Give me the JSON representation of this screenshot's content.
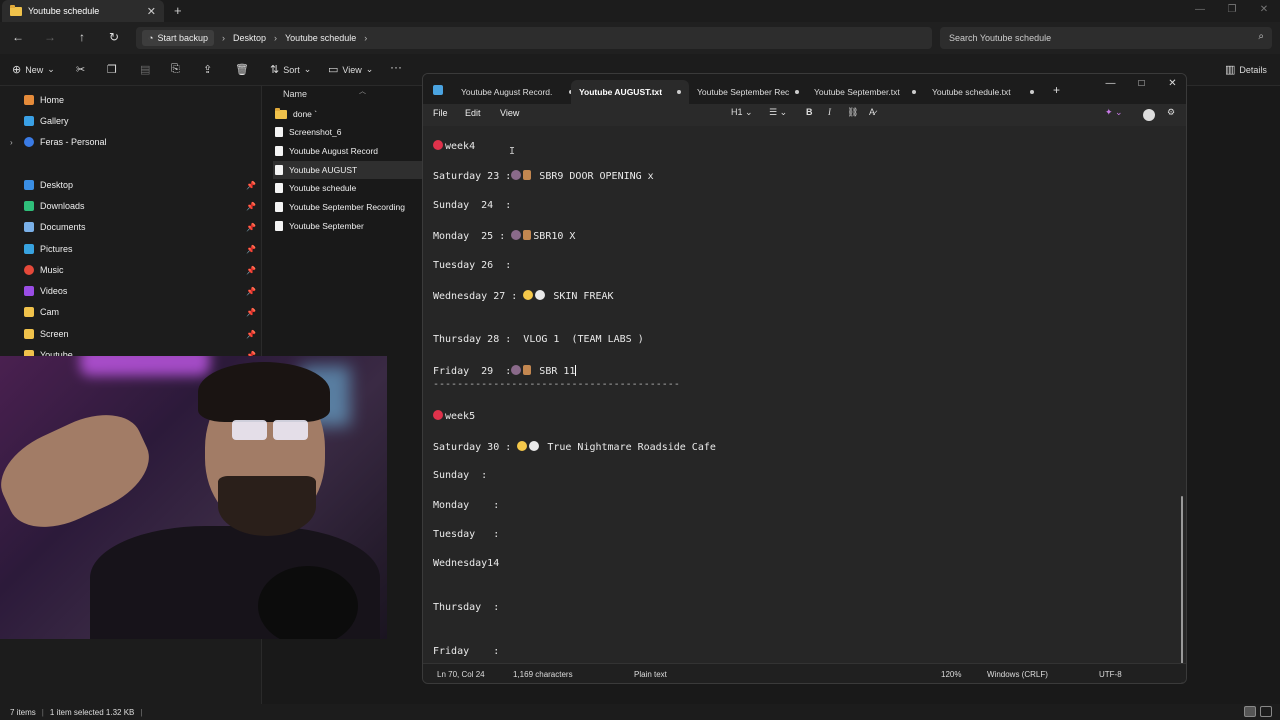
{
  "explorer": {
    "tab_title": "Youtube schedule",
    "new_tab": "+",
    "window_controls": [
      "—",
      "❐",
      "✕"
    ],
    "address": {
      "start_backup": "Start backup",
      "crumbs": [
        "Desktop",
        "Youtube schedule"
      ],
      "separator": "›"
    },
    "search_placeholder": "Search Youtube schedule",
    "commands": {
      "new": "New",
      "sort": "Sort",
      "view": "View",
      "more": "···",
      "details": "Details"
    },
    "sidebar": [
      {
        "label": "Home",
        "color": "#e58b3a"
      },
      {
        "label": "Gallery",
        "color": "#3aa0e5"
      },
      {
        "label": "Feras - Personal",
        "color": "#3a7be5"
      },
      {
        "label": "Desktop",
        "color": "#3a8fe5",
        "pinned": true
      },
      {
        "label": "Downloads",
        "color": "#2fbf7a",
        "pinned": true
      },
      {
        "label": "Documents",
        "color": "#7ab0e8",
        "pinned": true
      },
      {
        "label": "Pictures",
        "color": "#38a3e0",
        "pinned": true
      },
      {
        "label": "Music",
        "color": "#e5493a",
        "pinned": true
      },
      {
        "label": "Videos",
        "color": "#9a4de5",
        "pinned": true
      },
      {
        "label": "Cam",
        "color": "#f0c24b",
        "pinned": true
      },
      {
        "label": "Screen",
        "color": "#f0c24b",
        "pinned": true
      },
      {
        "label": "Youtube",
        "color": "#f0c24b",
        "pinned": true
      }
    ],
    "list_header": "Name",
    "files": [
      {
        "name": "done `",
        "type": "folder"
      },
      {
        "name": "Screenshot_6",
        "type": "file"
      },
      {
        "name": "Youtube August Record",
        "type": "file"
      },
      {
        "name": "Youtube AUGUST",
        "type": "file",
        "selected": true
      },
      {
        "name": "Youtube schedule",
        "type": "file"
      },
      {
        "name": "Youtube September Recording",
        "type": "file"
      },
      {
        "name": "Youtube September",
        "type": "file"
      }
    ],
    "status": {
      "items": "7 items",
      "selected": "1 item selected  1.32 KB"
    }
  },
  "notepad": {
    "tabs": [
      {
        "label": "Youtube August Record.",
        "modified": true
      },
      {
        "label": "Youtube AUGUST.txt",
        "modified": true,
        "active": true
      },
      {
        "label": "Youtube September Rec",
        "modified": true
      },
      {
        "label": "Youtube September.txt",
        "modified": true
      },
      {
        "label": "Youtube schedule.txt",
        "modified": true
      }
    ],
    "new_tab": "+",
    "menu": {
      "file": "File",
      "edit": "Edit",
      "view": "View"
    },
    "toolbar": {
      "heading": "H1",
      "bold": "B",
      "italic": "I"
    },
    "lines": {
      "week4": "week4",
      "sat23": "Saturday 23 :",
      "sat23_text": " SBR9 DOOR OPENING x",
      "sun24": "Sunday  24  :",
      "mon25": "Monday  25 : ",
      "mon25_text": "SBR10 X",
      "tue26": "Tuesday 26  :",
      "wed27": "Wednesday 27 : ",
      "wed27_text": " SKIN FREAK",
      "thu28": "Thursday 28 :  VLOG 1  (TEAM LABS )",
      "fri29": "Friday  29  :",
      "fri29_text": " SBR 11",
      "divider": "-----------------------------------------",
      "week5": "week5",
      "sat30": "Saturday 30 : ",
      "sat30_text": " True Nightmare Roadside Cafe",
      "sunday": "Sunday  :",
      "monday": "Monday    :",
      "tuesday": "Tuesday   :",
      "wednesday": "Wednesday14",
      "thursday": "Thursday  :",
      "friday": "Friday    :"
    },
    "status": {
      "position": "Ln 70, Col 24",
      "chars": "1,169 characters",
      "format": "Plain text",
      "zoom": "120%",
      "line_ending": "Windows (CRLF)",
      "encoding": "UTF-8"
    }
  }
}
